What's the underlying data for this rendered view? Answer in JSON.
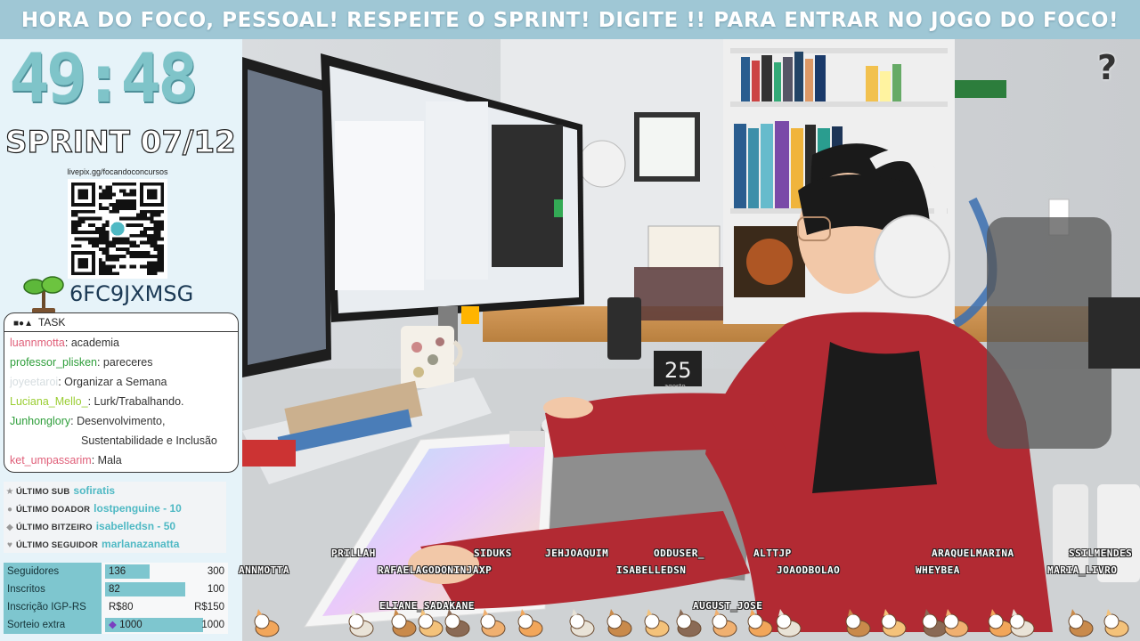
{
  "banner": {
    "text": "HORA DO FOCO, PESSOAL! RESPEITE O SPRINT! DIGITE !! PARA ENTRAR NO JOGO DO FOCO!"
  },
  "timer": {
    "value": "49:48"
  },
  "sprint": {
    "label": "SPRINT 07/12"
  },
  "donation": {
    "url": "livepix.gg/focandoconcursos",
    "code": "6FC9JXMSG"
  },
  "tasks": {
    "title": "TASK",
    "items": [
      {
        "user": "luannmotta",
        "user_color": "#e0607a",
        "task": "academia"
      },
      {
        "user": "professor_plisken",
        "user_color": "#2e9e3a",
        "task": "pareceres"
      },
      {
        "user": "joyeetaroi",
        "user_color": "#d6dde0",
        "task": "Organizar a Semana"
      },
      {
        "user": "Luciana_Mello_",
        "user_color": "#9acd32",
        "task": "Lurk/Trabalhando."
      },
      {
        "user": "Junhonglory",
        "user_color": "#2e9e3a",
        "task": "Desenvolvimento,",
        "task_cont": "Sustentabilidade e Inclusão"
      },
      {
        "user": "ket_umpassarim",
        "user_color": "#e0607a",
        "task": "Mala"
      }
    ]
  },
  "last": [
    {
      "icon": "star-icon",
      "label": "ÚLTIMO SUB",
      "value": "sofiratis"
    },
    {
      "icon": "drop-icon",
      "label": "ÚLTIMO DOADOR",
      "value": "lostpenguine - 10"
    },
    {
      "icon": "gem-icon",
      "label": "ÚLTIMO BITZEIRO",
      "value": "isabelledsn - 50"
    },
    {
      "icon": "heart-icon",
      "label": "ÚLTIMO SEGUIDOR",
      "value": "marlanazanatta"
    }
  ],
  "stats": [
    {
      "label": "Seguidores",
      "current": "136",
      "max": "300",
      "progress": 0.45
    },
    {
      "label": "Inscritos",
      "current": "82",
      "max": "100",
      "progress": 0.82
    },
    {
      "label": "Inscrição IGP-RS",
      "current": "R$80",
      "max": "R$150",
      "progress": 0.0
    },
    {
      "label": "Sorteio extra",
      "current": "1000",
      "max": "1000",
      "progress": 1.0,
      "icon": "gem-icon"
    }
  ],
  "calendar": {
    "day": "25",
    "month": "agosto"
  },
  "chatters": [
    "ANNMOTTA",
    "PRILLAH",
    "RAFAELAGODONINJAXP",
    "SIDUKS",
    "JEHJOAQUIM",
    "ODDUSER_",
    "ISABELLEDSN",
    "ALTTJP",
    "JOAODBOLAO",
    "ARAQUELMARINA",
    "WHEYBEA",
    "SSILMENDES",
    "MARIA_LIVRO",
    "ELIANE_SADAKANE",
    "AUGUST_JOSE"
  ],
  "colors": {
    "banner": "#9fc7d5",
    "timer": "#7fc4c9",
    "accent": "#7ec6cf",
    "last_value": "#4fb9c4"
  }
}
